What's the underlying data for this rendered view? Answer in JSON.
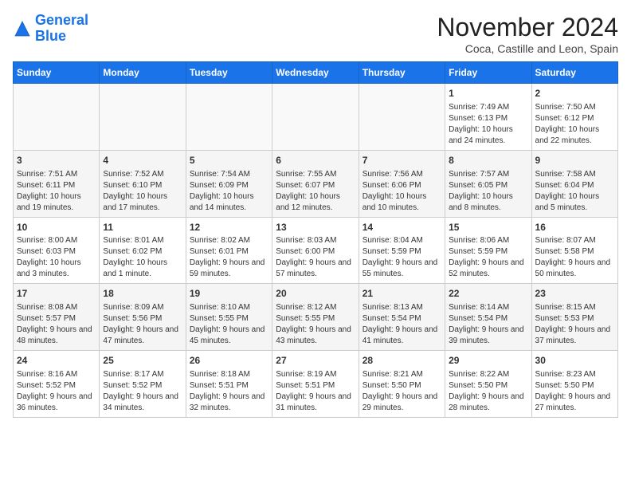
{
  "logo": {
    "line1": "General",
    "line2": "Blue"
  },
  "title": "November 2024",
  "subtitle": "Coca, Castille and Leon, Spain",
  "days_of_week": [
    "Sunday",
    "Monday",
    "Tuesday",
    "Wednesday",
    "Thursday",
    "Friday",
    "Saturday"
  ],
  "weeks": [
    [
      {
        "num": "",
        "detail": ""
      },
      {
        "num": "",
        "detail": ""
      },
      {
        "num": "",
        "detail": ""
      },
      {
        "num": "",
        "detail": ""
      },
      {
        "num": "",
        "detail": ""
      },
      {
        "num": "1",
        "detail": "Sunrise: 7:49 AM\nSunset: 6:13 PM\nDaylight: 10 hours and 24 minutes."
      },
      {
        "num": "2",
        "detail": "Sunrise: 7:50 AM\nSunset: 6:12 PM\nDaylight: 10 hours and 22 minutes."
      }
    ],
    [
      {
        "num": "3",
        "detail": "Sunrise: 7:51 AM\nSunset: 6:11 PM\nDaylight: 10 hours and 19 minutes."
      },
      {
        "num": "4",
        "detail": "Sunrise: 7:52 AM\nSunset: 6:10 PM\nDaylight: 10 hours and 17 minutes."
      },
      {
        "num": "5",
        "detail": "Sunrise: 7:54 AM\nSunset: 6:09 PM\nDaylight: 10 hours and 14 minutes."
      },
      {
        "num": "6",
        "detail": "Sunrise: 7:55 AM\nSunset: 6:07 PM\nDaylight: 10 hours and 12 minutes."
      },
      {
        "num": "7",
        "detail": "Sunrise: 7:56 AM\nSunset: 6:06 PM\nDaylight: 10 hours and 10 minutes."
      },
      {
        "num": "8",
        "detail": "Sunrise: 7:57 AM\nSunset: 6:05 PM\nDaylight: 10 hours and 8 minutes."
      },
      {
        "num": "9",
        "detail": "Sunrise: 7:58 AM\nSunset: 6:04 PM\nDaylight: 10 hours and 5 minutes."
      }
    ],
    [
      {
        "num": "10",
        "detail": "Sunrise: 8:00 AM\nSunset: 6:03 PM\nDaylight: 10 hours and 3 minutes."
      },
      {
        "num": "11",
        "detail": "Sunrise: 8:01 AM\nSunset: 6:02 PM\nDaylight: 10 hours and 1 minute."
      },
      {
        "num": "12",
        "detail": "Sunrise: 8:02 AM\nSunset: 6:01 PM\nDaylight: 9 hours and 59 minutes."
      },
      {
        "num": "13",
        "detail": "Sunrise: 8:03 AM\nSunset: 6:00 PM\nDaylight: 9 hours and 57 minutes."
      },
      {
        "num": "14",
        "detail": "Sunrise: 8:04 AM\nSunset: 5:59 PM\nDaylight: 9 hours and 55 minutes."
      },
      {
        "num": "15",
        "detail": "Sunrise: 8:06 AM\nSunset: 5:59 PM\nDaylight: 9 hours and 52 minutes."
      },
      {
        "num": "16",
        "detail": "Sunrise: 8:07 AM\nSunset: 5:58 PM\nDaylight: 9 hours and 50 minutes."
      }
    ],
    [
      {
        "num": "17",
        "detail": "Sunrise: 8:08 AM\nSunset: 5:57 PM\nDaylight: 9 hours and 48 minutes."
      },
      {
        "num": "18",
        "detail": "Sunrise: 8:09 AM\nSunset: 5:56 PM\nDaylight: 9 hours and 47 minutes."
      },
      {
        "num": "19",
        "detail": "Sunrise: 8:10 AM\nSunset: 5:55 PM\nDaylight: 9 hours and 45 minutes."
      },
      {
        "num": "20",
        "detail": "Sunrise: 8:12 AM\nSunset: 5:55 PM\nDaylight: 9 hours and 43 minutes."
      },
      {
        "num": "21",
        "detail": "Sunrise: 8:13 AM\nSunset: 5:54 PM\nDaylight: 9 hours and 41 minutes."
      },
      {
        "num": "22",
        "detail": "Sunrise: 8:14 AM\nSunset: 5:54 PM\nDaylight: 9 hours and 39 minutes."
      },
      {
        "num": "23",
        "detail": "Sunrise: 8:15 AM\nSunset: 5:53 PM\nDaylight: 9 hours and 37 minutes."
      }
    ],
    [
      {
        "num": "24",
        "detail": "Sunrise: 8:16 AM\nSunset: 5:52 PM\nDaylight: 9 hours and 36 minutes."
      },
      {
        "num": "25",
        "detail": "Sunrise: 8:17 AM\nSunset: 5:52 PM\nDaylight: 9 hours and 34 minutes."
      },
      {
        "num": "26",
        "detail": "Sunrise: 8:18 AM\nSunset: 5:51 PM\nDaylight: 9 hours and 32 minutes."
      },
      {
        "num": "27",
        "detail": "Sunrise: 8:19 AM\nSunset: 5:51 PM\nDaylight: 9 hours and 31 minutes."
      },
      {
        "num": "28",
        "detail": "Sunrise: 8:21 AM\nSunset: 5:50 PM\nDaylight: 9 hours and 29 minutes."
      },
      {
        "num": "29",
        "detail": "Sunrise: 8:22 AM\nSunset: 5:50 PM\nDaylight: 9 hours and 28 minutes."
      },
      {
        "num": "30",
        "detail": "Sunrise: 8:23 AM\nSunset: 5:50 PM\nDaylight: 9 hours and 27 minutes."
      }
    ]
  ]
}
